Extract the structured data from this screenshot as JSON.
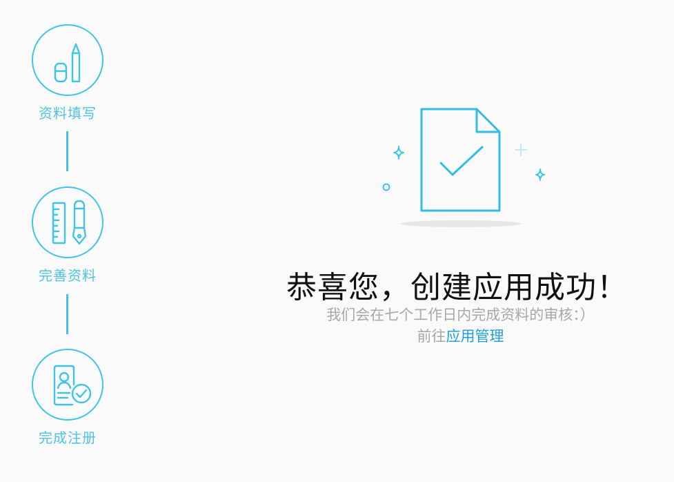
{
  "steps": [
    {
      "label": "资料填写",
      "icon": "eraser-pencil-icon"
    },
    {
      "label": "完善资料",
      "icon": "ruler-pen-icon"
    },
    {
      "label": "完成注册",
      "icon": "profile-check-icon"
    }
  ],
  "success": {
    "illustration_icon": "document-check-icon",
    "title": "恭喜您，创建应用成功！",
    "message": "我们会在七个工作日内完成资料的审核：）",
    "goto_prefix": "前往",
    "goto_link": "应用管理"
  },
  "colors": {
    "accent": "#3ec5e6",
    "link": "#1e9ee0",
    "muted_text": "#a8a8a8",
    "background": "#fafafa"
  }
}
